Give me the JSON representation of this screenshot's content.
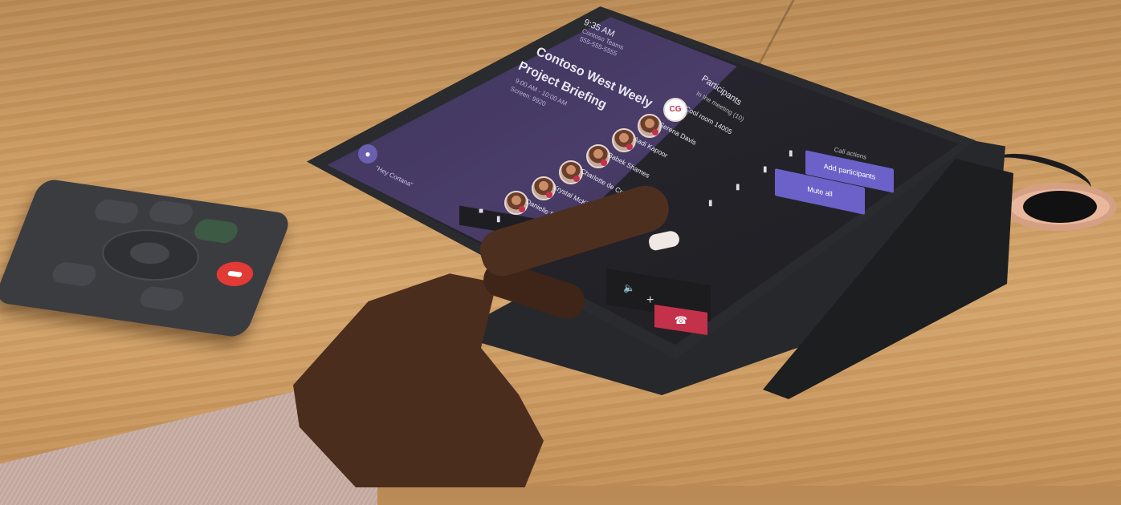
{
  "meeting": {
    "time": "9:35 AM",
    "subtitle_1": "Contoso Teams",
    "subtitle_2": "555-555-5555",
    "title_line1": "Contoso West Weely",
    "title_line2": "Project Briefing",
    "time_range": "9:00 AM - 10:00 AM",
    "room_id": "Screen: 9920"
  },
  "voice_prompt": "\"Hey Cortana\"",
  "participants_panel": {
    "tab_label": "Participants",
    "in_meeting": "In the meeting (10)",
    "people": [
      {
        "initials": "CG",
        "name": "Cool room 14005"
      },
      {
        "name": "Serena Davis"
      },
      {
        "name": "Aadi Kapoor"
      },
      {
        "name": "Babek Shames"
      },
      {
        "name": "Charlotte de Crum"
      },
      {
        "name": "Krystal McKinney"
      },
      {
        "name": "Danielle Booker"
      }
    ]
  },
  "call_actions": {
    "heading": "Call actions",
    "add_participants": "Add participants",
    "mute_all": "Mute all"
  },
  "bottom_bar": {
    "speaker_icon": "speaker-icon",
    "plus_icon": "plus-icon",
    "hangup_icon": "hangup-icon"
  },
  "colors": {
    "accent": "#6b61c8",
    "hangup": "#c4314b",
    "remote_red": "#e23a35"
  }
}
